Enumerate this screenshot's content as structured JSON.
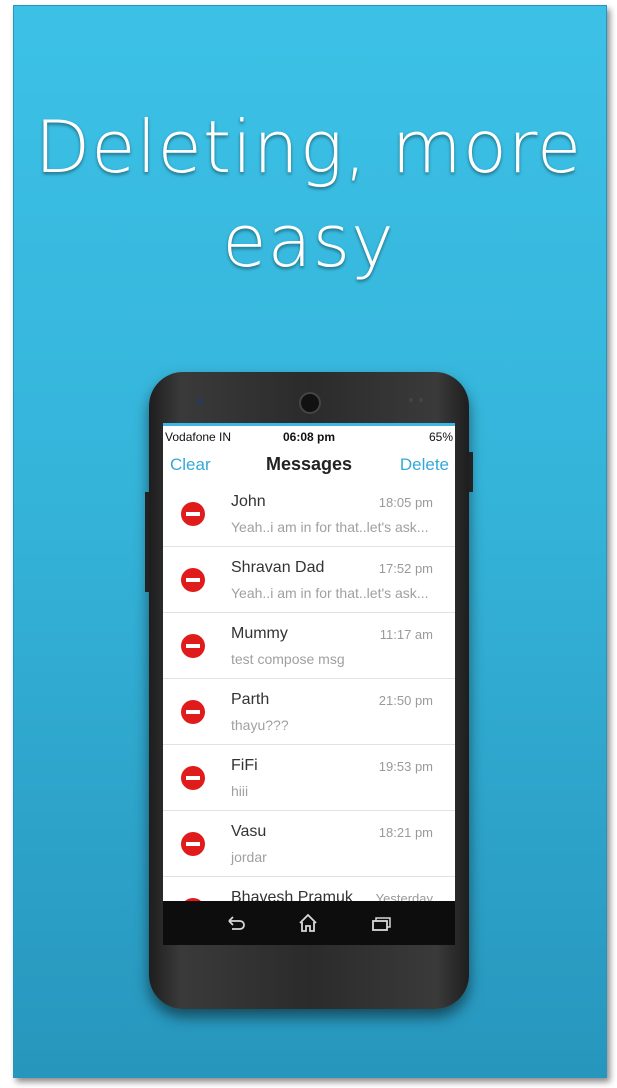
{
  "headline": {
    "line1": "Deleting, more",
    "line2": "easy"
  },
  "status_bar": {
    "carrier": "Vodafone IN",
    "time": "06:08 pm",
    "battery": "65%"
  },
  "nav": {
    "left": "Clear",
    "title": "Messages",
    "right": "Delete"
  },
  "conversations": [
    {
      "name": "John",
      "time": "18:05 pm",
      "preview": "Yeah..i am in for that..let's ask..."
    },
    {
      "name": "Shravan Dad",
      "time": "17:52 pm",
      "preview": "Yeah..i am in for that..let's ask..."
    },
    {
      "name": "Mummy",
      "time": "11:17 am",
      "preview": "test compose msg"
    },
    {
      "name": "Parth",
      "time": "21:50 pm",
      "preview": "thayu???"
    },
    {
      "name": "FiFi",
      "time": "19:53 pm",
      "preview": "hiii"
    },
    {
      "name": "Vasu",
      "time": "18:21 pm",
      "preview": "jordar"
    },
    {
      "name": "Bhavesh Pramuk",
      "time": "Yesterday",
      "preview": ""
    }
  ],
  "softkeys": {
    "back_icon": "back-icon",
    "home_icon": "home-icon",
    "recents_icon": "recents-icon"
  },
  "colors": {
    "background": "#3cc1e6",
    "accent": "#34a9d8",
    "delete_red": "#e01b1b"
  }
}
